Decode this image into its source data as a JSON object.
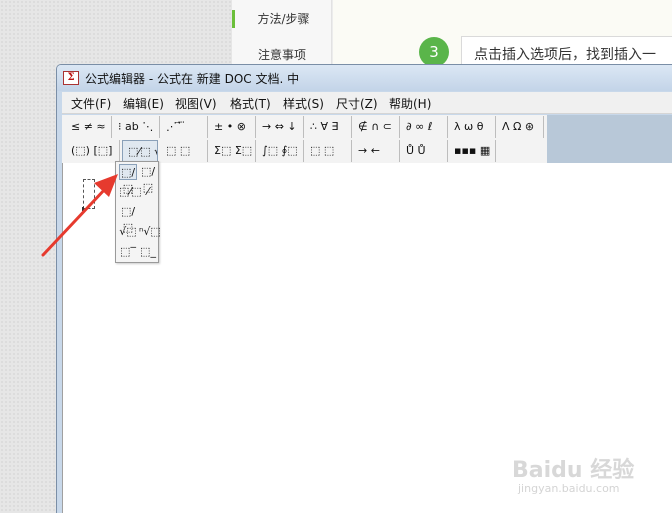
{
  "background_page": {
    "side_nav": [
      {
        "label": "方法/步骤",
        "active": true
      },
      {
        "label": "注意事项",
        "active": false
      }
    ],
    "step_number": "3",
    "step_text": "点击插入选项后，找到插入一"
  },
  "window": {
    "title": "公式编辑器 - 公式在 新建 DOC 文档. 中",
    "app_icon": "Σ"
  },
  "menu": [
    "文件(F)",
    "编辑(E)",
    "视图(V)",
    "格式(T)",
    "样式(S)",
    "尺寸(Z)",
    "帮助(H)"
  ],
  "toolbar": {
    "row1": [
      "≤ ≠ ≈",
      "⁝ ab ⋱",
      "⋰ ⃗ ⃛",
      "± • ⊗",
      "→ ⇔ ↓",
      "∴ ∀ ∃",
      "∉ ∩ ⊂",
      "∂ ∞ ℓ",
      "λ ω θ",
      "Λ Ω ⊛"
    ],
    "row2": [
      "(⬚) [⬚]",
      "⬚⁄⬚ √⬚",
      "⬚ ⬚",
      "Σ⬚ Σ⬚",
      "∫⬚ ∮⬚",
      "⬚ ⬚",
      "→ ←",
      "Ů Ů",
      "▪▪▪ ▦"
    ]
  },
  "fraction_palette": [
    [
      "⬚/⬚",
      "⬚/⬚"
    ],
    [
      "⬚⁄⬚",
      "⁄"
    ],
    [
      "⬚/⬚",
      ""
    ],
    [
      "√⬚",
      "ⁿ√⬚"
    ],
    [
      "⬚‾",
      "⬚_"
    ]
  ],
  "watermark": {
    "logo": "Baidu 经验",
    "url": "jingyan.baidu.com"
  },
  "colors": {
    "accent_green": "#5ab54a",
    "annotation_red": "#e63a2e",
    "window_frame": "#c8d8ea"
  }
}
